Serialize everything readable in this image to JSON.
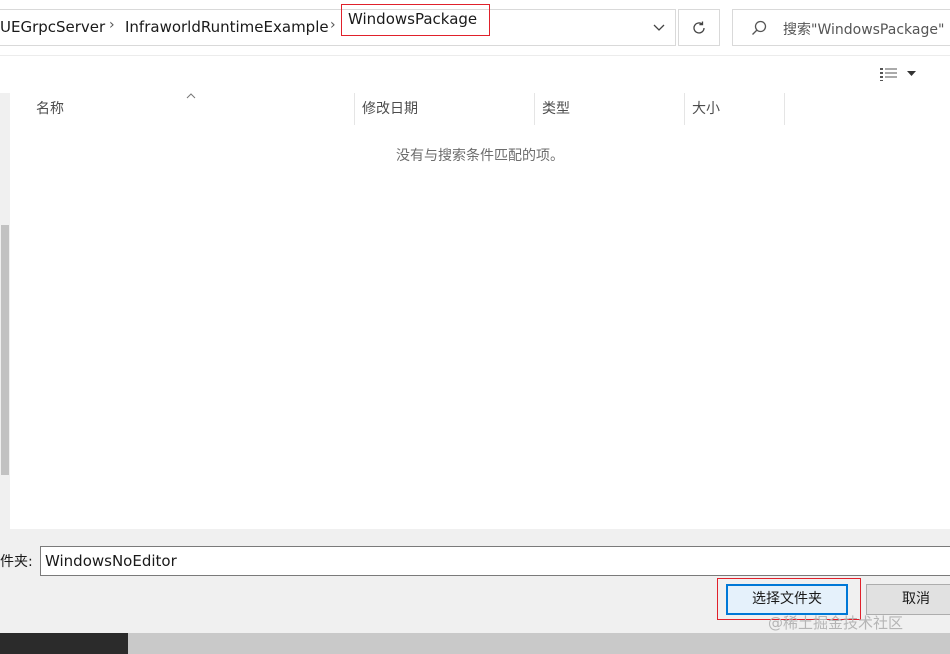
{
  "address_bar": {
    "breadcrumbs": [
      "UEGrpcServer",
      "InfraworldRuntimeExample",
      "WindowsPackage"
    ],
    "search_placeholder": "搜索\"WindowsPackage\""
  },
  "file_list": {
    "columns": [
      "名称",
      "修改日期",
      "类型",
      "大小"
    ],
    "empty_message": "没有与搜索条件匹配的项。"
  },
  "folder_field": {
    "label": "件夹:",
    "value": "WindowsNoEditor"
  },
  "buttons": {
    "select_folder": "选择文件夹",
    "cancel": "取消"
  },
  "watermark": "@稀土掘金技术社区",
  "colors": {
    "highlight": "#e0212b",
    "primary_button_border": "#0078d7"
  }
}
